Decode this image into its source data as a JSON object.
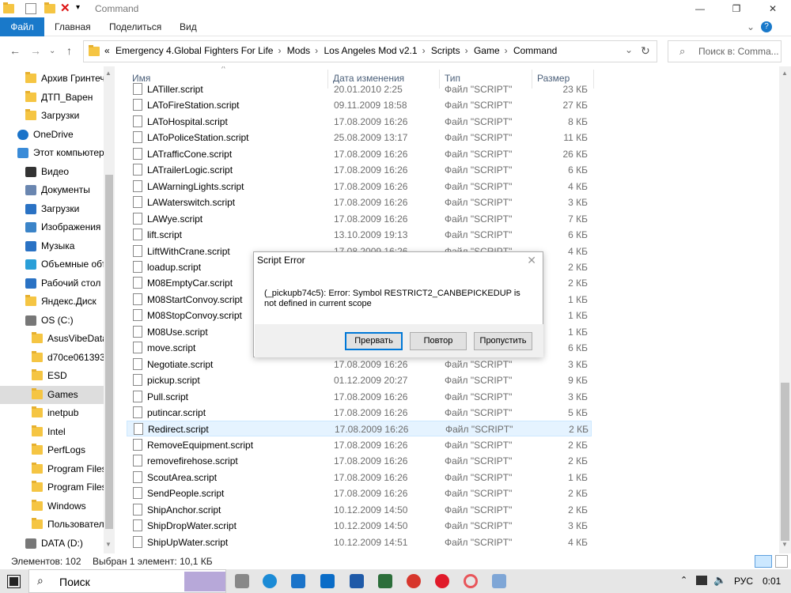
{
  "window": {
    "title": "Command",
    "min": "—",
    "max": "❐",
    "close": "✕"
  },
  "ribbon": {
    "tabs": [
      "Файл",
      "Главная",
      "Поделиться",
      "Вид"
    ],
    "help": "?"
  },
  "address": {
    "prefix": "«",
    "crumbs": [
      "Emergency 4.Global Fighters For Life",
      "Mods",
      "Los Angeles Mod v2.1",
      "Scripts",
      "Game",
      "Command"
    ],
    "search_placeholder": "Поиск в: Comma..."
  },
  "nav": {
    "items": [
      {
        "label": "Архив Гринтеч",
        "icon": "folder"
      },
      {
        "label": "ДТП_Варен",
        "icon": "folder"
      },
      {
        "label": "Загрузки",
        "icon": "folder"
      },
      {
        "label": "OneDrive",
        "icon": "cloud"
      },
      {
        "label": "Этот компьютер",
        "icon": "pc"
      },
      {
        "label": "Видео",
        "icon": "video"
      },
      {
        "label": "Документы",
        "icon": "docs"
      },
      {
        "label": "Загрузки",
        "icon": "downloads"
      },
      {
        "label": "Изображения",
        "icon": "images"
      },
      {
        "label": "Музыка",
        "icon": "music"
      },
      {
        "label": "Объемные объ",
        "icon": "3d"
      },
      {
        "label": "Рабочий стол",
        "icon": "desktop"
      },
      {
        "label": "Яндекс.Диск",
        "icon": "folder"
      },
      {
        "label": "OS (C:)",
        "icon": "drive"
      },
      {
        "label": "AsusVibeData",
        "icon": "folder"
      },
      {
        "label": "d70ce0613931",
        "icon": "folder"
      },
      {
        "label": "ESD",
        "icon": "folder"
      },
      {
        "label": "Games",
        "icon": "folder"
      },
      {
        "label": "inetpub",
        "icon": "folder"
      },
      {
        "label": "Intel",
        "icon": "folder"
      },
      {
        "label": "PerfLogs",
        "icon": "folder"
      },
      {
        "label": "Program Files",
        "icon": "folder"
      },
      {
        "label": "Program Files",
        "icon": "folder"
      },
      {
        "label": "Windows",
        "icon": "folder"
      },
      {
        "label": "Пользовател",
        "icon": "folder"
      },
      {
        "label": "DATA (D:)",
        "icon": "drive"
      }
    ]
  },
  "columns": {
    "name": "Имя",
    "date": "Дата изменения",
    "type": "Тип",
    "size": "Размер"
  },
  "files": [
    {
      "name": "LATiller.script",
      "date": "20.01.2010 2:25",
      "type": "Файл \"SCRIPT\"",
      "size": "23 КБ"
    },
    {
      "name": "LAToFireStation.script",
      "date": "09.11.2009 18:58",
      "type": "Файл \"SCRIPT\"",
      "size": "27 КБ"
    },
    {
      "name": "LAToHospital.script",
      "date": "17.08.2009 16:26",
      "type": "Файл \"SCRIPT\"",
      "size": "8 КБ"
    },
    {
      "name": "LAToPoliceStation.script",
      "date": "25.08.2009 13:17",
      "type": "Файл \"SCRIPT\"",
      "size": "11 КБ"
    },
    {
      "name": "LATrafficCone.script",
      "date": "17.08.2009 16:26",
      "type": "Файл \"SCRIPT\"",
      "size": "26 КБ"
    },
    {
      "name": "LATrailerLogic.script",
      "date": "17.08.2009 16:26",
      "type": "Файл \"SCRIPT\"",
      "size": "6 КБ"
    },
    {
      "name": "LAWarningLights.script",
      "date": "17.08.2009 16:26",
      "type": "Файл \"SCRIPT\"",
      "size": "4 КБ"
    },
    {
      "name": "LAWaterswitch.script",
      "date": "17.08.2009 16:26",
      "type": "Файл \"SCRIPT\"",
      "size": "3 КБ"
    },
    {
      "name": "LAWye.script",
      "date": "17.08.2009 16:26",
      "type": "Файл \"SCRIPT\"",
      "size": "7 КБ"
    },
    {
      "name": "lift.script",
      "date": "13.10.2009 19:13",
      "type": "Файл \"SCRIPT\"",
      "size": "6 КБ"
    },
    {
      "name": "LiftWithCrane.script",
      "date": "17.08.2009 16:26",
      "type": "Файл \"SCRIPT\"",
      "size": "4 КБ"
    },
    {
      "name": "loadup.script",
      "date": "",
      "type": "",
      "size": "2 КБ"
    },
    {
      "name": "M08EmptyCar.script",
      "date": "",
      "type": "",
      "size": "2 КБ"
    },
    {
      "name": "M08StartConvoy.script",
      "date": "",
      "type": "",
      "size": "1 КБ"
    },
    {
      "name": "M08StopConvoy.script",
      "date": "",
      "type": "",
      "size": "1 КБ"
    },
    {
      "name": "M08Use.script",
      "date": "",
      "type": "",
      "size": "1 КБ"
    },
    {
      "name": "move.script",
      "date": "",
      "type": "",
      "size": "6 КБ"
    },
    {
      "name": "Negotiate.script",
      "date": "17.08.2009 16:26",
      "type": "Файл \"SCRIPT\"",
      "size": "3 КБ"
    },
    {
      "name": "pickup.script",
      "date": "01.12.2009 20:27",
      "type": "Файл \"SCRIPT\"",
      "size": "9 КБ"
    },
    {
      "name": "Pull.script",
      "date": "17.08.2009 16:26",
      "type": "Файл \"SCRIPT\"",
      "size": "3 КБ"
    },
    {
      "name": "putincar.script",
      "date": "17.08.2009 16:26",
      "type": "Файл \"SCRIPT\"",
      "size": "5 КБ"
    },
    {
      "name": "Redirect.script",
      "date": "17.08.2009 16:26",
      "type": "Файл \"SCRIPT\"",
      "size": "2 КБ",
      "selected": true
    },
    {
      "name": "RemoveEquipment.script",
      "date": "17.08.2009 16:26",
      "type": "Файл \"SCRIPT\"",
      "size": "2 КБ"
    },
    {
      "name": "removefirehose.script",
      "date": "17.08.2009 16:26",
      "type": "Файл \"SCRIPT\"",
      "size": "2 КБ"
    },
    {
      "name": "ScoutArea.script",
      "date": "17.08.2009 16:26",
      "type": "Файл \"SCRIPT\"",
      "size": "1 КБ"
    },
    {
      "name": "SendPeople.script",
      "date": "17.08.2009 16:26",
      "type": "Файл \"SCRIPT\"",
      "size": "2 КБ"
    },
    {
      "name": "ShipAnchor.script",
      "date": "10.12.2009 14:50",
      "type": "Файл \"SCRIPT\"",
      "size": "2 КБ"
    },
    {
      "name": "ShipDropWater.script",
      "date": "10.12.2009 14:50",
      "type": "Файл \"SCRIPT\"",
      "size": "3 КБ"
    },
    {
      "name": "ShipUpWater.script",
      "date": "10.12.2009 14:51",
      "type": "Файл \"SCRIPT\"",
      "size": "4 КБ"
    }
  ],
  "status": {
    "count": "Элементов: 102",
    "selected": "Выбран 1 элемент: 10,1 КБ"
  },
  "dialog": {
    "title": "Script Error",
    "close": "✕",
    "message": "(_pickupb74c5): Error: Symbol RESTRICT2_CANBEPICKEDUP is not defined in current scope",
    "buttons": [
      "Прервать",
      "Повтор",
      "Пропустить"
    ]
  },
  "taskbar": {
    "search": "Поиск",
    "lang": "РУС",
    "time": "0:01"
  }
}
